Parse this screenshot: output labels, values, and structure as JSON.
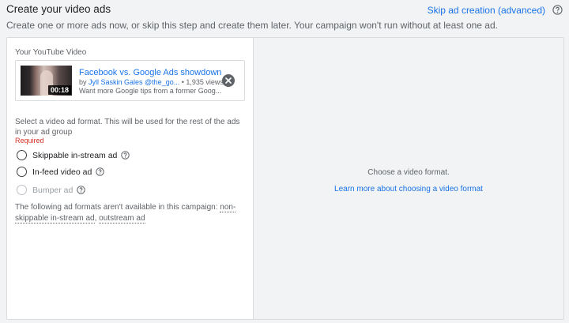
{
  "header": {
    "title": "Create your video ads",
    "subtitle": "Create one or more ads now, or skip this step and create them later. Your campaign won't run without at least one ad.",
    "skip_link": "Skip ad creation (advanced)"
  },
  "video": {
    "section_label": "Your YouTube Video",
    "title": "Facebook vs. Google Ads showdown",
    "by_prefix": "by ",
    "channel": "Jyll Saskin Gales @the_go...",
    "views": " • 1,935 views",
    "description": "Want more Google tips from a former Goog...",
    "duration": "00:18"
  },
  "format": {
    "prompt": "Select a video ad format. This will be used for the rest of the ads in your ad group",
    "required": "Required",
    "options": [
      {
        "label": "Skippable in-stream ad",
        "disabled": false
      },
      {
        "label": "In-feed video ad",
        "disabled": false
      },
      {
        "label": "Bumper ad",
        "disabled": true
      }
    ],
    "unavailable_prefix": "The following ad formats aren't available in this campaign: ",
    "unavailable_1": "non-skippable in-stream ad",
    "unavailable_sep": ", ",
    "unavailable_2": "outstream ad"
  },
  "preview": {
    "choose_text": "Choose a video format.",
    "learn_link": "Learn more about choosing a video format"
  },
  "colors": {
    "link": "#1a73e8",
    "required": "#d93025",
    "background": "#f1f3f4"
  }
}
